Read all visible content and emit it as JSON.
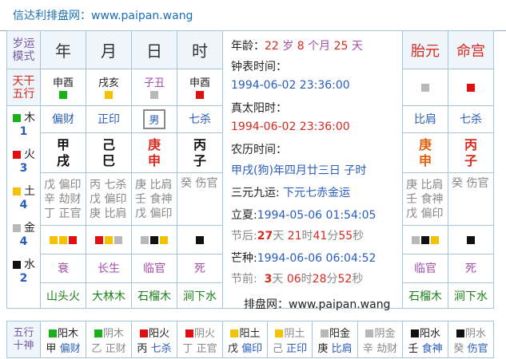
{
  "header": {
    "title": "信达利排盘网：www.paipan.wang"
  },
  "labels": {
    "dayun": [
      "岁运",
      "模式"
    ],
    "ganwu": [
      "天干",
      "五行"
    ],
    "footer_left": [
      "五行",
      "十神"
    ]
  },
  "columns": {
    "headers": [
      "年",
      "月",
      "日",
      "时"
    ],
    "extra_headers": [
      "胎元",
      "命宫"
    ],
    "zhu": [
      "申酉",
      "戌亥",
      "子丑",
      "申酉"
    ],
    "zhu_sq": [
      "c-green",
      "c-yellow",
      "c-gray",
      "c-red"
    ],
    "shishen_top": [
      "偏财",
      "正印",
      "男",
      "七杀"
    ],
    "gan": [
      "甲",
      "己",
      "庚",
      "丙"
    ],
    "zhi": [
      "戌",
      "巳",
      "申",
      "子"
    ],
    "canggan": [
      [
        "戊 偏印",
        "辛 劫财",
        "丁 正官"
      ],
      [
        "丙 七杀",
        "戊 偏印",
        "庚 比肩"
      ],
      [
        "庚 比肩",
        "壬 食神",
        "戊 偏印"
      ],
      [
        "癸 伤官",
        "",
        ""
      ]
    ],
    "squares": [
      [
        "c-yellow",
        "c-yellow",
        "c-red"
      ],
      [
        "c-red",
        "c-yellow",
        "c-gray"
      ],
      [
        "c-gray",
        "c-black",
        "c-yellow"
      ],
      [
        "c-black"
      ]
    ],
    "changsheng": [
      "衰",
      "长生",
      "临官",
      "死"
    ],
    "nayin": [
      "山头火",
      "大林木",
      "石榴木",
      "涧下水"
    ]
  },
  "extra": {
    "top_sq": [
      "c-gray",
      "c-red"
    ],
    "shishen_top": [
      "比肩",
      "七杀"
    ],
    "gan": [
      "庚",
      "丙"
    ],
    "zhi": [
      "申",
      "子"
    ],
    "canggan": [
      [
        "庚 比肩",
        "壬 食神",
        "戊 偏印"
      ],
      [
        "癸 伤官",
        "",
        ""
      ]
    ],
    "squares": [
      [
        "c-gray",
        "c-black",
        "c-yellow"
      ],
      [
        "c-black"
      ]
    ],
    "changsheng": [
      "临官",
      "死"
    ],
    "nayin": [
      "石榴木",
      "涧下水"
    ]
  },
  "left_elements": [
    {
      "sq": "c-green",
      "name": "木",
      "count": "1"
    },
    {
      "sq": "c-red",
      "name": "火",
      "count": "3"
    },
    {
      "sq": "c-yellow",
      "name": "土",
      "count": "4"
    },
    {
      "sq": "c-gray",
      "name": "金",
      "count": "4"
    },
    {
      "sq": "c-black",
      "name": "水",
      "count": "2"
    }
  ],
  "info": {
    "age_label": "年龄：",
    "age_years": "22",
    "age_sui": "岁",
    "age_months": "8",
    "age_month_unit": "个月",
    "age_days": "25",
    "age_day_unit": "天",
    "clock_label": "钟表时间：",
    "clock_value": "1994-06-02 23:36:00",
    "solar_label": "真太阳时：",
    "solar_value": "1994-06-02 23:36:00",
    "lunar_label": "农历时间：",
    "lunar_value": "甲戌(狗)年四月廿三日 子时",
    "sanyuan_label": "三元九运:",
    "sanyuan_value": "下元七赤金运",
    "lixia_label": "立夏:",
    "lixia_value": "1994-05-06 01:54:05",
    "after_label": "节后:",
    "after_days": "27",
    "after_day_unit": "天",
    "after_hours": "21",
    "after_hour_unit": "时",
    "after_mins": "41",
    "after_min_unit": "分",
    "after_secs": "55",
    "after_sec_unit": "秒",
    "mangzhong_label": "芒种:",
    "mangzhong_value": "1994-06-06 06:04:52",
    "before_label": "节前:",
    "before_days": "3",
    "before_day_unit": "天",
    "before_hours": "06",
    "before_hour_unit": "时",
    "before_mins": "28",
    "before_min_unit": "分",
    "before_secs": "52",
    "before_sec_unit": "秒",
    "site": "排盘网：www.paipan.wang"
  },
  "footer": [
    {
      "sq": "c-green",
      "yy": "阳木",
      "gan": "甲",
      "god": "偏财"
    },
    {
      "sq": "c-green",
      "yy": "阴木",
      "gan": "乙",
      "god": "正财"
    },
    {
      "sq": "c-red",
      "yy": "阳火",
      "gan": "丙",
      "god": "七杀"
    },
    {
      "sq": "c-red",
      "yy": "阴火",
      "gan": "丁",
      "god": "正官"
    },
    {
      "sq": "c-yellow",
      "yy": "阳土",
      "gan": "戊",
      "god": "偏印"
    },
    {
      "sq": "c-yellow",
      "yy": "阴土",
      "gan": "己",
      "god": "正印"
    },
    {
      "sq": "c-gray",
      "yy": "阳金",
      "gan": "庚",
      "god": "比肩"
    },
    {
      "sq": "c-gray",
      "yy": "阴金",
      "gan": "辛",
      "god": "劫财"
    },
    {
      "sq": "c-black",
      "yy": "阳水",
      "gan": "壬",
      "god": "食神"
    },
    {
      "sq": "c-black",
      "yy": "阴水",
      "gan": "癸",
      "god": "伤官"
    }
  ]
}
